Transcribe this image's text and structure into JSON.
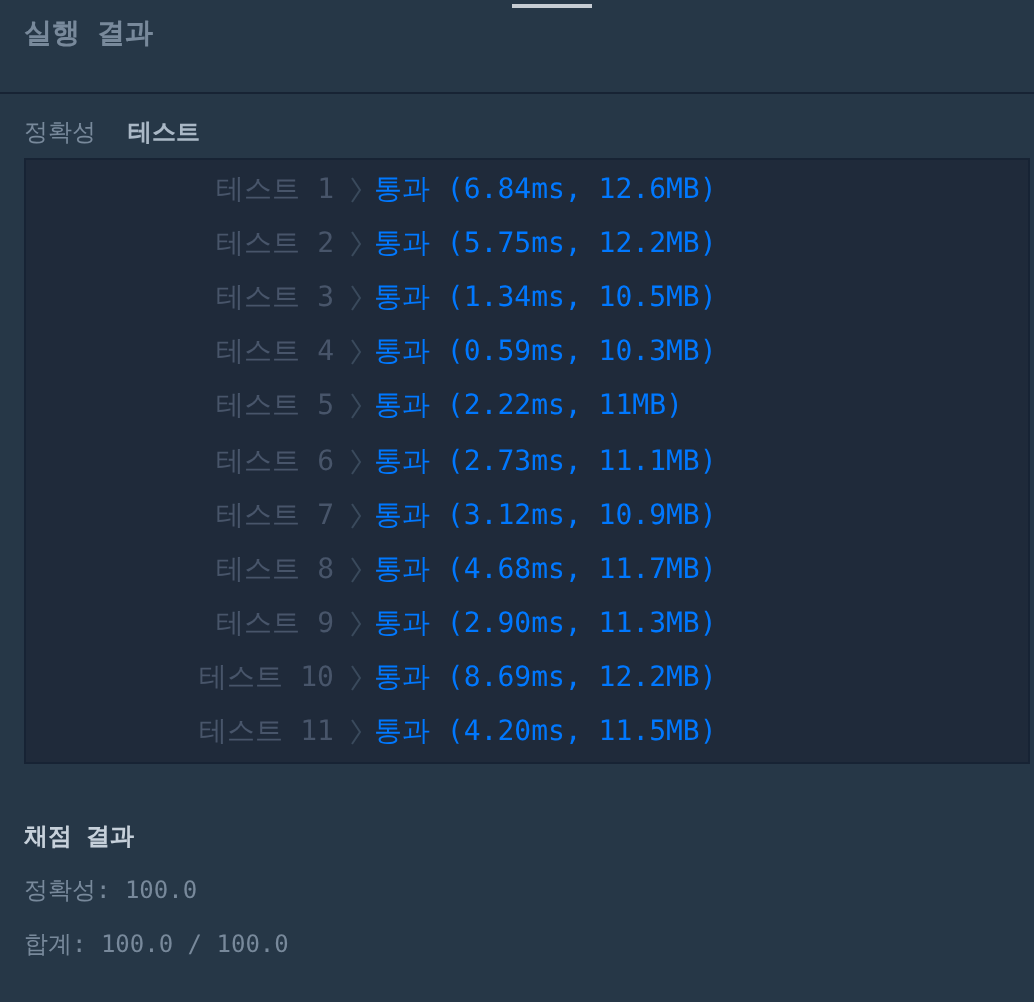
{
  "header": {
    "title": "실행 결과"
  },
  "tabs": [
    {
      "label": "정확성",
      "selected": false
    },
    {
      "label": "테스트",
      "selected": true
    }
  ],
  "tests": [
    {
      "label": "테스트 1",
      "result": "통과 (6.84ms, 12.6MB)"
    },
    {
      "label": "테스트 2",
      "result": "통과 (5.75ms, 12.2MB)"
    },
    {
      "label": "테스트 3",
      "result": "통과 (1.34ms, 10.5MB)"
    },
    {
      "label": "테스트 4",
      "result": "통과 (0.59ms, 10.3MB)"
    },
    {
      "label": "테스트 5",
      "result": "통과 (2.22ms, 11MB)"
    },
    {
      "label": "테스트 6",
      "result": "통과 (2.73ms, 11.1MB)"
    },
    {
      "label": "테스트 7",
      "result": "통과 (3.12ms, 10.9MB)"
    },
    {
      "label": "테스트 8",
      "result": "통과 (4.68ms, 11.7MB)"
    },
    {
      "label": "테스트 9",
      "result": "통과 (2.90ms, 11.3MB)"
    },
    {
      "label": "테스트 10",
      "result": "통과 (8.69ms, 12.2MB)"
    },
    {
      "label": "테스트 11",
      "result": "통과 (4.20ms, 11.5MB)"
    }
  ],
  "summary": {
    "title": "채점 결과",
    "lines": [
      "정확성: 100.0",
      "합계: 100.0 / 100.0"
    ]
  }
}
